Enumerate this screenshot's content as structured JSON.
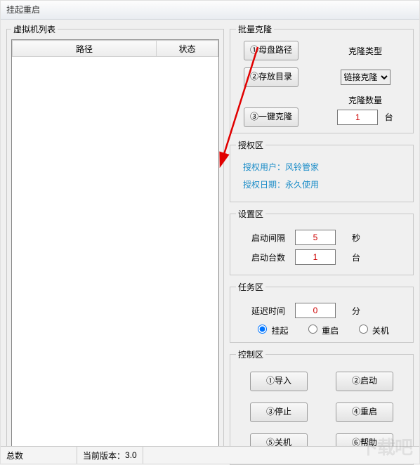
{
  "window": {
    "title": "挂起重启"
  },
  "vmlist": {
    "title": "虚拟机列表",
    "columns": [
      "路径",
      "状态"
    ],
    "rows": []
  },
  "clone": {
    "title": "批量克隆",
    "btn_mother": "①母盘路径",
    "btn_dir": "②存放目录",
    "btn_go": "③一键克隆",
    "type_label": "克隆类型",
    "type_options": [
      "链接克隆"
    ],
    "type_selected": "链接克隆",
    "count_label": "克隆数量",
    "count_value": "1",
    "count_unit": "台"
  },
  "auth": {
    "title": "授权区",
    "user_label": "授权用户：",
    "user_value": "风铃管家",
    "date_label": "授权日期：",
    "date_value": "永久使用"
  },
  "settings": {
    "title": "设置区",
    "interval_label": "启动间隔",
    "interval_value": "5",
    "interval_unit": "秒",
    "count_label": "启动台数",
    "count_value": "1",
    "count_unit": "台"
  },
  "task": {
    "title": "任务区",
    "delay_label": "延迟时间",
    "delay_value": "0",
    "delay_unit": "分",
    "radios": {
      "suspend": "挂起",
      "restart": "重启",
      "shutdown": "关机"
    },
    "selected": "suspend"
  },
  "control": {
    "title": "控制区",
    "btn_import": "①导入",
    "btn_start": "②启动",
    "btn_stop": "③停止",
    "btn_restart": "④重启",
    "btn_shutdown": "⑤关机",
    "btn_help": "⑥帮助"
  },
  "status": {
    "total_label": "总数",
    "version_label": "当前版本：",
    "version_value": "3.0"
  },
  "watermark": "下载吧"
}
